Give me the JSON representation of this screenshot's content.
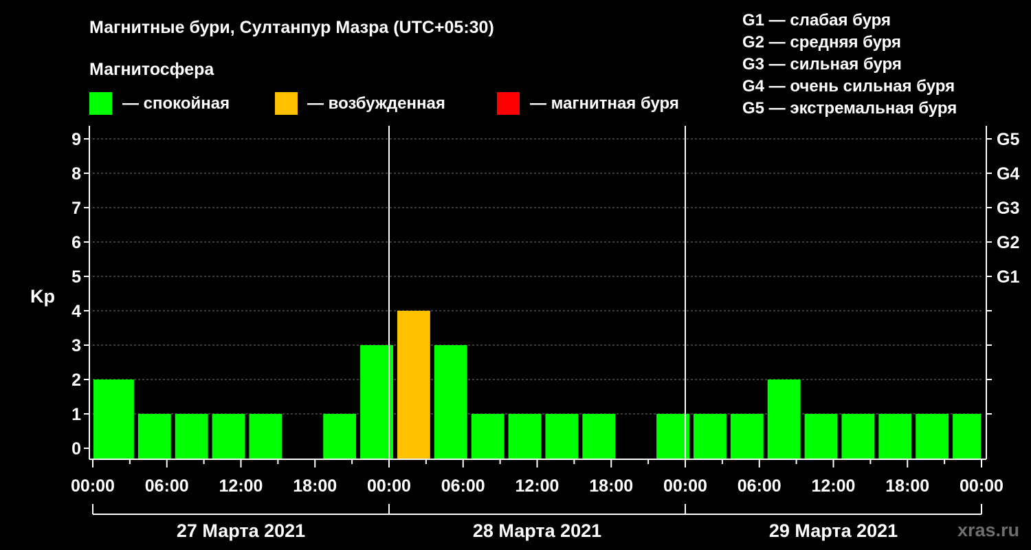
{
  "title": "Магнитные бури, Султанпур Мазра (UTC+05:30)",
  "legend": {
    "heading": "Магнитосфера",
    "items": [
      {
        "label": "— спокойная",
        "color": "#00ff00"
      },
      {
        "label": "— возбужденная",
        "color": "#ffc000"
      },
      {
        "label": "— магнитная буря",
        "color": "#ff0000"
      }
    ]
  },
  "storm_scale": [
    "G1 — слабая буря",
    "G2 — средняя буря",
    "G3 — сильная буря",
    "G4 — очень сильная буря",
    "G5 — экстремальная буря"
  ],
  "watermark": "xras.ru",
  "chart_data": {
    "type": "bar",
    "ylabel": "Kp",
    "ylim": [
      0,
      9
    ],
    "yticks": [
      "0",
      "1",
      "2",
      "3",
      "4",
      "5",
      "6",
      "7",
      "8",
      "9"
    ],
    "right_ticks": [
      {
        "kp": 5,
        "label": "G1"
      },
      {
        "kp": 6,
        "label": "G2"
      },
      {
        "kp": 7,
        "label": "G3"
      },
      {
        "kp": 8,
        "label": "G4"
      },
      {
        "kp": 9,
        "label": "G5"
      }
    ],
    "interval_hours": 3,
    "total_hours": 72,
    "first_bar_start_hour": 0.5,
    "xtick_labels": [
      "00:00",
      "06:00",
      "12:00",
      "18:00",
      "00:00",
      "06:00",
      "12:00",
      "18:00",
      "00:00",
      "06:00",
      "12:00",
      "18:00",
      "00:00"
    ],
    "days": [
      "27 Марта 2021",
      "28 Марта 2021",
      "29 Марта 2021"
    ],
    "values": [
      2,
      2,
      1,
      1,
      1,
      1,
      0,
      1,
      3,
      4,
      3,
      1,
      1,
      1,
      1,
      0,
      1,
      1,
      1,
      2,
      1,
      1,
      1,
      1,
      1
    ],
    "colors": [
      "#00ff00",
      "#00ff00",
      "#00ff00",
      "#00ff00",
      "#00ff00",
      "#00ff00",
      "#00ff00",
      "#00ff00",
      "#00ff00",
      "#ffc000",
      "#00ff00",
      "#00ff00",
      "#00ff00",
      "#00ff00",
      "#00ff00",
      "#00ff00",
      "#00ff00",
      "#00ff00",
      "#00ff00",
      "#00ff00",
      "#00ff00",
      "#00ff00",
      "#00ff00",
      "#00ff00",
      "#00ff00"
    ]
  }
}
